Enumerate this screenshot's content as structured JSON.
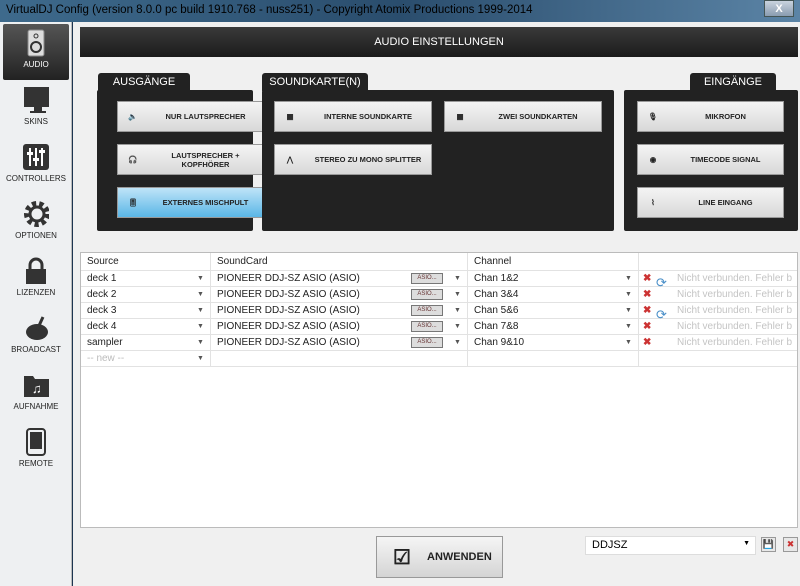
{
  "window": {
    "title": "VirtualDJ Config (version 8.0.0 pc build 1910.768 - nuss251) - Copyright Atomix Productions 1999-2014",
    "close": "X"
  },
  "sidebar": {
    "items": [
      {
        "label": "AUDIO",
        "icon": "speaker-icon"
      },
      {
        "label": "SKINS",
        "icon": "monitor-icon"
      },
      {
        "label": "CONTROLLERS",
        "icon": "sliders-icon"
      },
      {
        "label": "OPTIONEN",
        "icon": "gear-icon"
      },
      {
        "label": "LIZENZEN",
        "icon": "lock-icon"
      },
      {
        "label": "BROADCAST",
        "icon": "broadcast-icon"
      },
      {
        "label": "AUFNAHME",
        "icon": "music-folder-icon"
      },
      {
        "label": "REMOTE",
        "icon": "tablet-icon"
      }
    ]
  },
  "header": {
    "title": "AUDIO EINSTELLUNGEN"
  },
  "outputs": {
    "tab": "AUSGÄNGE",
    "buttons": [
      "NUR LAUTSPRECHER",
      "LAUTSPRECHER + KOPFHÖRER",
      "EXTERNES MISCHPULT"
    ]
  },
  "soundcards": {
    "tab": "SOUNDKARTE(N)",
    "buttons": [
      "INTERNE SOUNDKARTE",
      "ZWEI SOUNDKARTEN",
      "STEREO ZU MONO SPLITTER"
    ]
  },
  "inputs": {
    "tab": "EINGÄNGE",
    "buttons": [
      "MIKROFON",
      "TIMECODE SIGNAL",
      "LINE EINGANG"
    ]
  },
  "table": {
    "headers": [
      "Source",
      "SoundCard",
      "Channel"
    ],
    "rows": [
      {
        "source": "deck 1",
        "card": "PIONEER DDJ-SZ ASIO (ASIO)",
        "asio": "ASIO...",
        "channel": "Chan 1&2",
        "status": "Nicht verbunden. Fehler b"
      },
      {
        "source": "deck 2",
        "card": "PIONEER DDJ-SZ ASIO (ASIO)",
        "asio": "ASIO...",
        "channel": "Chan 3&4",
        "status": "Nicht verbunden. Fehler b"
      },
      {
        "source": "deck 3",
        "card": "PIONEER DDJ-SZ ASIO (ASIO)",
        "asio": "ASIO...",
        "channel": "Chan 5&6",
        "status": "Nicht verbunden. Fehler b"
      },
      {
        "source": "deck 4",
        "card": "PIONEER DDJ-SZ ASIO (ASIO)",
        "asio": "ASIO...",
        "channel": "Chan 7&8",
        "status": "Nicht verbunden. Fehler b"
      },
      {
        "source": "sampler",
        "card": "PIONEER DDJ-SZ ASIO (ASIO)",
        "asio": "ASIO...",
        "channel": "Chan 9&10",
        "status": "Nicht verbunden. Fehler b"
      }
    ],
    "new_placeholder": "-- new --"
  },
  "footer": {
    "apply": "ANWENDEN",
    "profile": "DDJSZ"
  }
}
